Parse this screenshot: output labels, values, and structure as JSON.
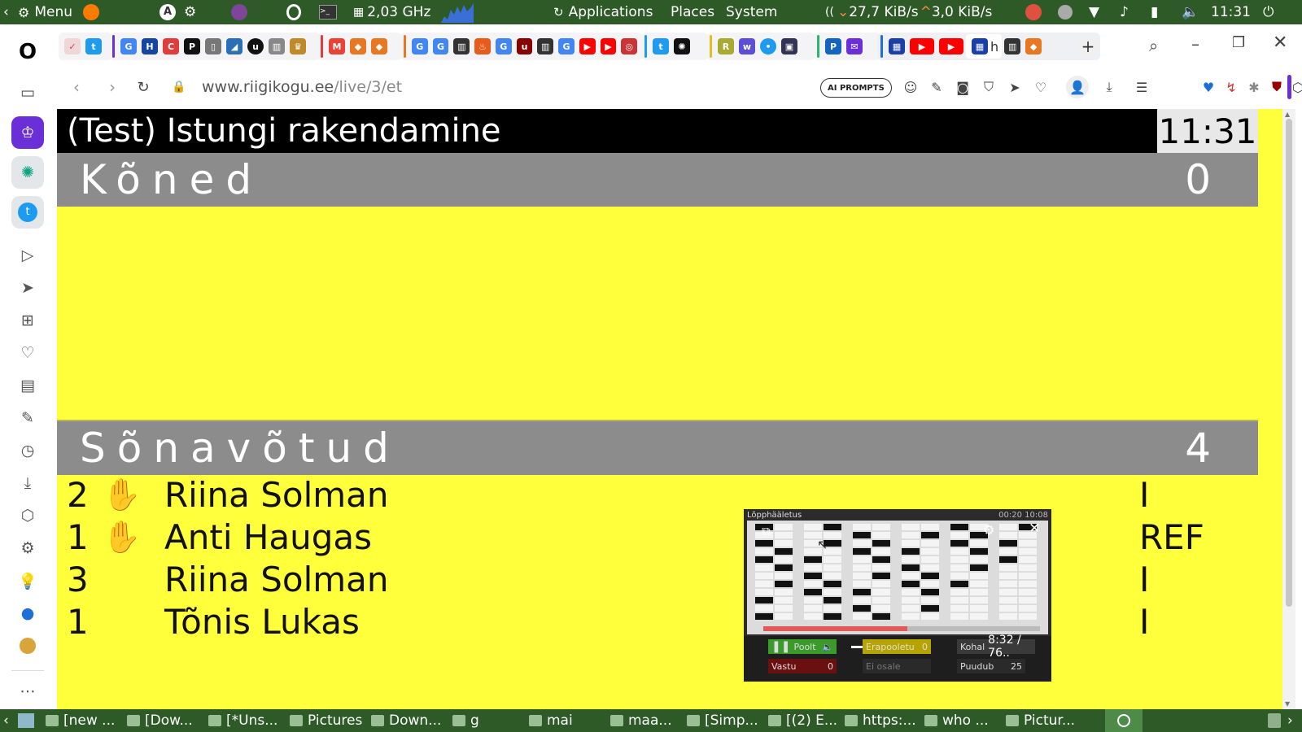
{
  "os_panel": {
    "menu_label": "Menu",
    "cpu_freq": "2,03 GHz",
    "applications": "Applications",
    "places": "Places",
    "system": "System",
    "net_down": "27,7 KiB/s",
    "net_up": "3,0 KiB/s",
    "clock": "11:31"
  },
  "browser": {
    "url_domain": "www.riigikogu.ee",
    "url_path": "/live/3/et",
    "ai_prompts": "AI PROMPTS",
    "active_tab_letter": "h"
  },
  "page": {
    "title": "(Test) Istungi rakendamine",
    "clock": "11:31",
    "speeches": {
      "label": "Kõned",
      "count": "0"
    },
    "requests": {
      "label": "Sõnavõtud",
      "count": "4"
    },
    "speakers": [
      {
        "num": "2",
        "hand": true,
        "name": "Riina Solman",
        "tag": "I"
      },
      {
        "num": "1",
        "hand": true,
        "name": "Anti Haugas",
        "tag": "REF"
      },
      {
        "num": "3",
        "hand": false,
        "name": "Riina Solman",
        "tag": "I"
      },
      {
        "num": "1",
        "hand": false,
        "name": "Tõnis Lukas",
        "tag": "I"
      }
    ]
  },
  "video_popup": {
    "caption": "Lõpphääletus",
    "time_info": "00:20   10:08",
    "playback_time": "8:32 / 76..",
    "progress": 0.52,
    "votes": {
      "poolt_label": "Poolt",
      "vastu_label": "Vastu",
      "vastu_count": "0",
      "erapooletu_label": "Erapooletu",
      "erapooletu_count": "0",
      "ei_osale_label": "Ei osale",
      "kohal_label": "Kohal",
      "puudub_label": "Puudub",
      "puudub_count": "25"
    }
  },
  "taskbar": {
    "items": [
      "[new ...",
      "[Dow...",
      "[*Uns...",
      "Pictures",
      "Down...",
      "g",
      "mai",
      "maa...",
      "[Simp...",
      "[(2) E...",
      "https:...",
      "who ...",
      "Pictur..."
    ]
  }
}
